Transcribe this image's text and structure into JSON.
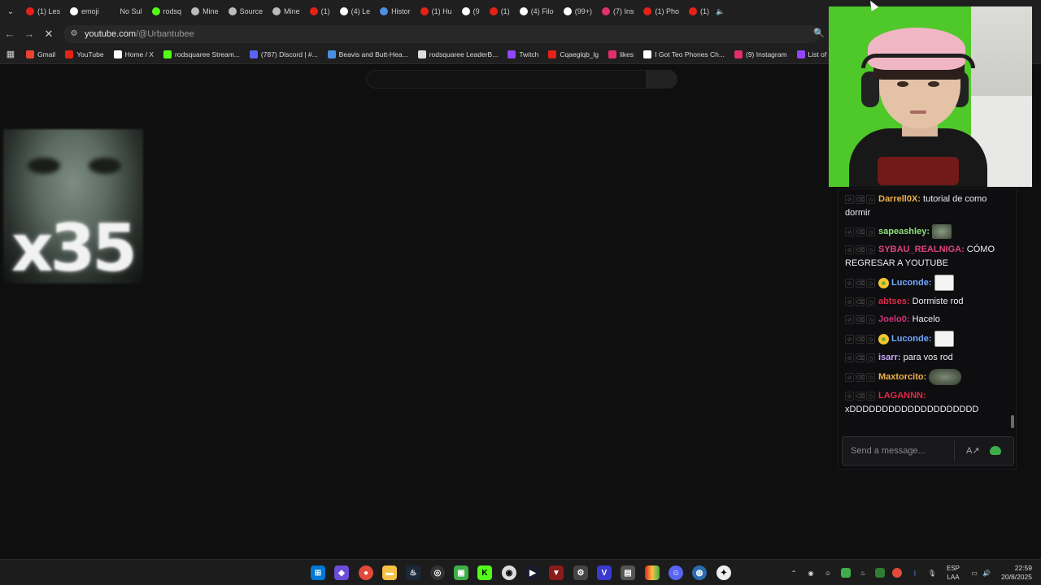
{
  "browser": {
    "tabs": [
      {
        "label": "(1) Les",
        "color": "#e62117"
      },
      {
        "label": "emoji",
        "color": "#ffffff"
      },
      {
        "label": "No Sul",
        "color": "#1f1f1f"
      },
      {
        "label": "rodsq",
        "color": "#53fc18"
      },
      {
        "label": "Mine",
        "color": "#bbbbbb"
      },
      {
        "label": "Source",
        "color": "#bbbbbb"
      },
      {
        "label": "Mine",
        "color": "#bbbbbb"
      },
      {
        "label": "(1)",
        "color": "#e62117"
      },
      {
        "label": "(4) Le",
        "color": "#ffffff"
      },
      {
        "label": "Histor",
        "color": "#4a90e2"
      },
      {
        "label": "(1) Hu",
        "color": "#e62117"
      },
      {
        "label": "(9",
        "color": "#ffffff"
      },
      {
        "label": "(1)",
        "color": "#e62117"
      },
      {
        "label": "(4) Filo",
        "color": "#ffffff"
      },
      {
        "label": "(99+)",
        "color": "#ffffff"
      },
      {
        "label": "(7) Ins",
        "color": "#e1306c"
      },
      {
        "label": "(1) Pho",
        "color": "#e62117"
      },
      {
        "label": "(1)",
        "color": "#e62117"
      }
    ],
    "url_host": "youtube.com",
    "url_path": "/@Urbantubee",
    "bookmarks": [
      {
        "label": "Gmail",
        "color": "#ea4335"
      },
      {
        "label": "YouTube",
        "color": "#e62117"
      },
      {
        "label": "Home / X",
        "color": "#ffffff"
      },
      {
        "label": "rodsquaree Stream...",
        "color": "#53fc18"
      },
      {
        "label": "(787) Discord | #...",
        "color": "#5865f2"
      },
      {
        "label": "Beavis and Butt-Hea...",
        "color": "#4a90e2"
      },
      {
        "label": "rodsquaree LeaderB...",
        "color": "#dddddd"
      },
      {
        "label": "Twitch",
        "color": "#9146ff"
      },
      {
        "label": "Cqaeglqb_lg",
        "color": "#e62117"
      },
      {
        "label": "likes",
        "color": "#e1306c"
      },
      {
        "label": "I Got Teo Phones Ch...",
        "color": "#ffffff"
      },
      {
        "label": "(9) Instagram",
        "color": "#e1306c"
      },
      {
        "label": "List of Prohibited",
        "color": "#9146ff"
      }
    ]
  },
  "overlay": {
    "emote_count": "x35"
  },
  "chat": {
    "messages": [
      {
        "user": "Darrell0X:",
        "user_color": "#f0b34b",
        "text": "tutorial de como dormir",
        "emote": null,
        "badge": false
      },
      {
        "user": "sapeashley:",
        "user_color": "#8fe07b",
        "text": "",
        "emote": "frog",
        "badge": false
      },
      {
        "user": "SYBAU_REALNIGA:",
        "user_color": "#e0457b",
        "text": "CÓMO REGRESAR A YOUTUBE",
        "emote": null,
        "badge": false
      },
      {
        "user": "Luconde:",
        "user_color": "#6fa8ff",
        "text": "",
        "emote": "troll",
        "badge": true
      },
      {
        "user": "abtses:",
        "user_color": "#e0294a",
        "text": "Dormiste rod",
        "emote": null,
        "badge": false
      },
      {
        "user": "Joelo0:",
        "user_color": "#d0317a",
        "text": "Hacelo",
        "emote": null,
        "badge": false
      },
      {
        "user": "Luconde:",
        "user_color": "#6fa8ff",
        "text": "",
        "emote": "troll",
        "badge": true
      },
      {
        "user": "isarr:",
        "user_color": "#c8a6ff",
        "text": "para vos rod",
        "emote": null,
        "badge": false
      },
      {
        "user": "Maxtorcito:",
        "user_color": "#f0b34b",
        "text": "",
        "emote": "frog-wide",
        "badge": false
      },
      {
        "user": "LAGANNN:",
        "user_color": "#e0294a",
        "text": "xDDDDDDDDDDDDDDDDDDDD",
        "emote": null,
        "badge": false
      }
    ],
    "input_placeholder": "Send a message..."
  },
  "taskbar": {
    "lang_line1": "ESP",
    "lang_line2": "LAA",
    "time": "22:59",
    "date": "20/8/2025"
  }
}
